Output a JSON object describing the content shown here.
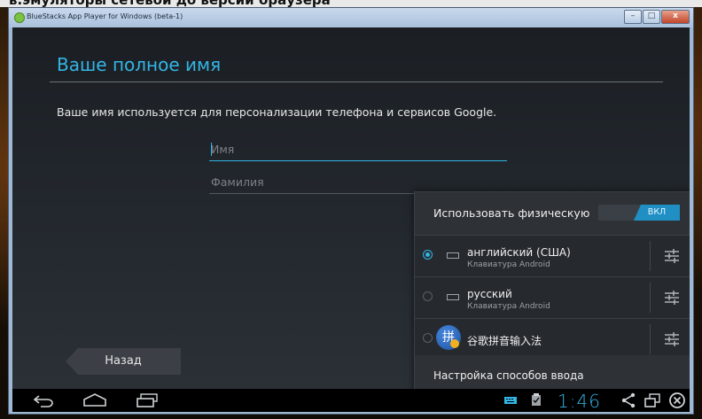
{
  "desktop": {
    "caption_fragment": "в.эмуляторы сетевой до версии браузера"
  },
  "window": {
    "title": "BlueStacks App Player for Windows (beta-1)",
    "minimize": "–",
    "maximize": "□",
    "close": "x"
  },
  "setup": {
    "title": "Ваше полное имя",
    "description": "Ваше имя используется для персонализации телефона и сервисов Google.",
    "first_name_placeholder": "Имя",
    "last_name_placeholder": "Фамилия",
    "back_label": "Назад"
  },
  "ime_popup": {
    "physical_keyboard_label": "Использовать физическую клавиатуру",
    "toggle_label": "ВКЛ",
    "methods": [
      {
        "name": "английский (США)",
        "subtitle": "Клавиатура Android",
        "selected": true
      },
      {
        "name": "русский",
        "subtitle": "Клавиатура Android",
        "selected": false
      },
      {
        "name": "谷歌拼音输入法",
        "subtitle": "",
        "selected": false,
        "icon_glyph": "拼"
      }
    ],
    "settings_label": "Настройка способов ввода"
  },
  "system_bar": {
    "clock": "1:46"
  },
  "colors": {
    "accent": "#33b5e5",
    "toggle_on": "#1f8fc4"
  }
}
